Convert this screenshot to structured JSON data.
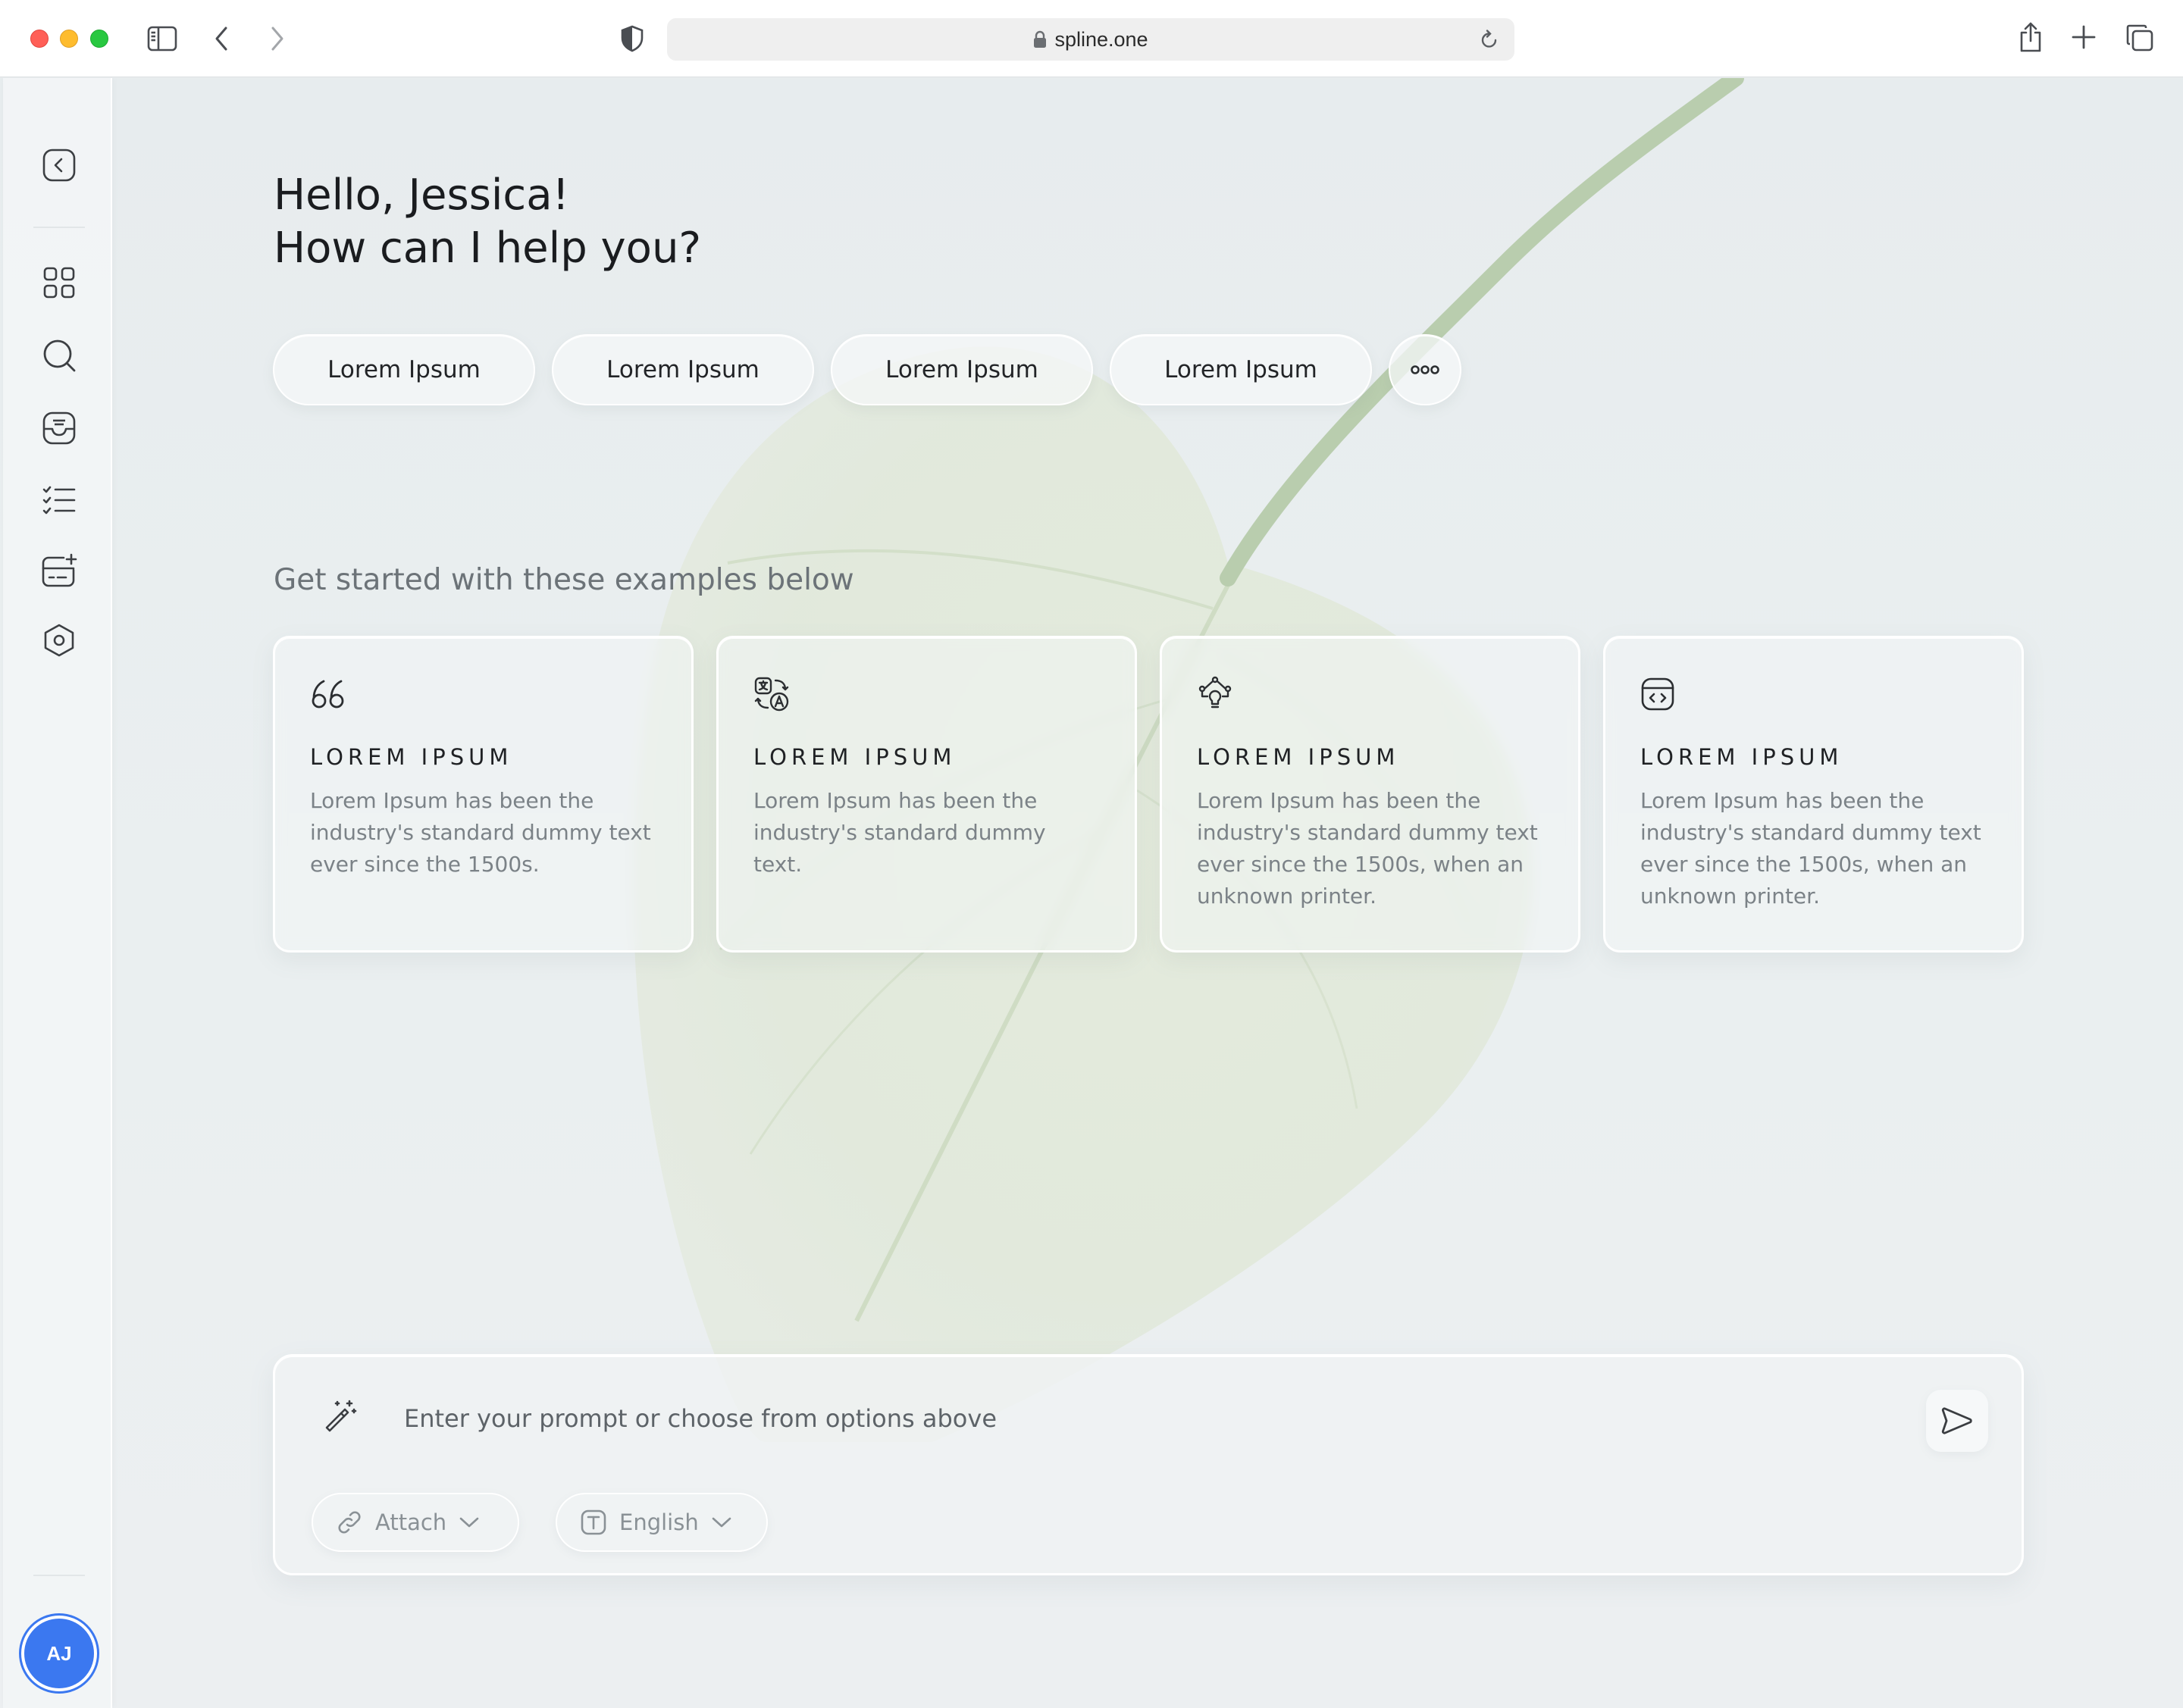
{
  "browser": {
    "url": "spline.one"
  },
  "sidebar": {
    "avatar_initials": "AJ"
  },
  "greeting": {
    "line1": "Hello, Jessica!",
    "line2": "How can I help you?"
  },
  "chips": [
    {
      "label": "Lorem Ipsum"
    },
    {
      "label": "Lorem Ipsum"
    },
    {
      "label": "Lorem Ipsum"
    },
    {
      "label": "Lorem Ipsum"
    }
  ],
  "examples": {
    "heading": "Get started with these examples below",
    "cards": [
      {
        "icon": "quote-icon",
        "title": "LOREM IPSUM",
        "description": "Lorem Ipsum has been the industry's standard dummy text ever since the 1500s."
      },
      {
        "icon": "translate-icon",
        "title": "LOREM IPSUM",
        "description": "Lorem Ipsum has been the industry's standard dummy text."
      },
      {
        "icon": "idea-network-icon",
        "title": "LOREM IPSUM",
        "description": "Lorem Ipsum has been the industry's standard dummy text ever since the 1500s, when an unknown printer."
      },
      {
        "icon": "code-browser-icon",
        "title": "LOREM IPSUM",
        "description": "Lorem Ipsum has been the industry's standard dummy text ever since the 1500s, when an unknown printer."
      }
    ]
  },
  "prompt": {
    "placeholder": "Enter your prompt or choose from options above",
    "attach_label": "Attach",
    "language_label": "English"
  },
  "colors": {
    "accent": "#3b78f0",
    "background": "#e9edee",
    "card_border": "#ffffff"
  }
}
